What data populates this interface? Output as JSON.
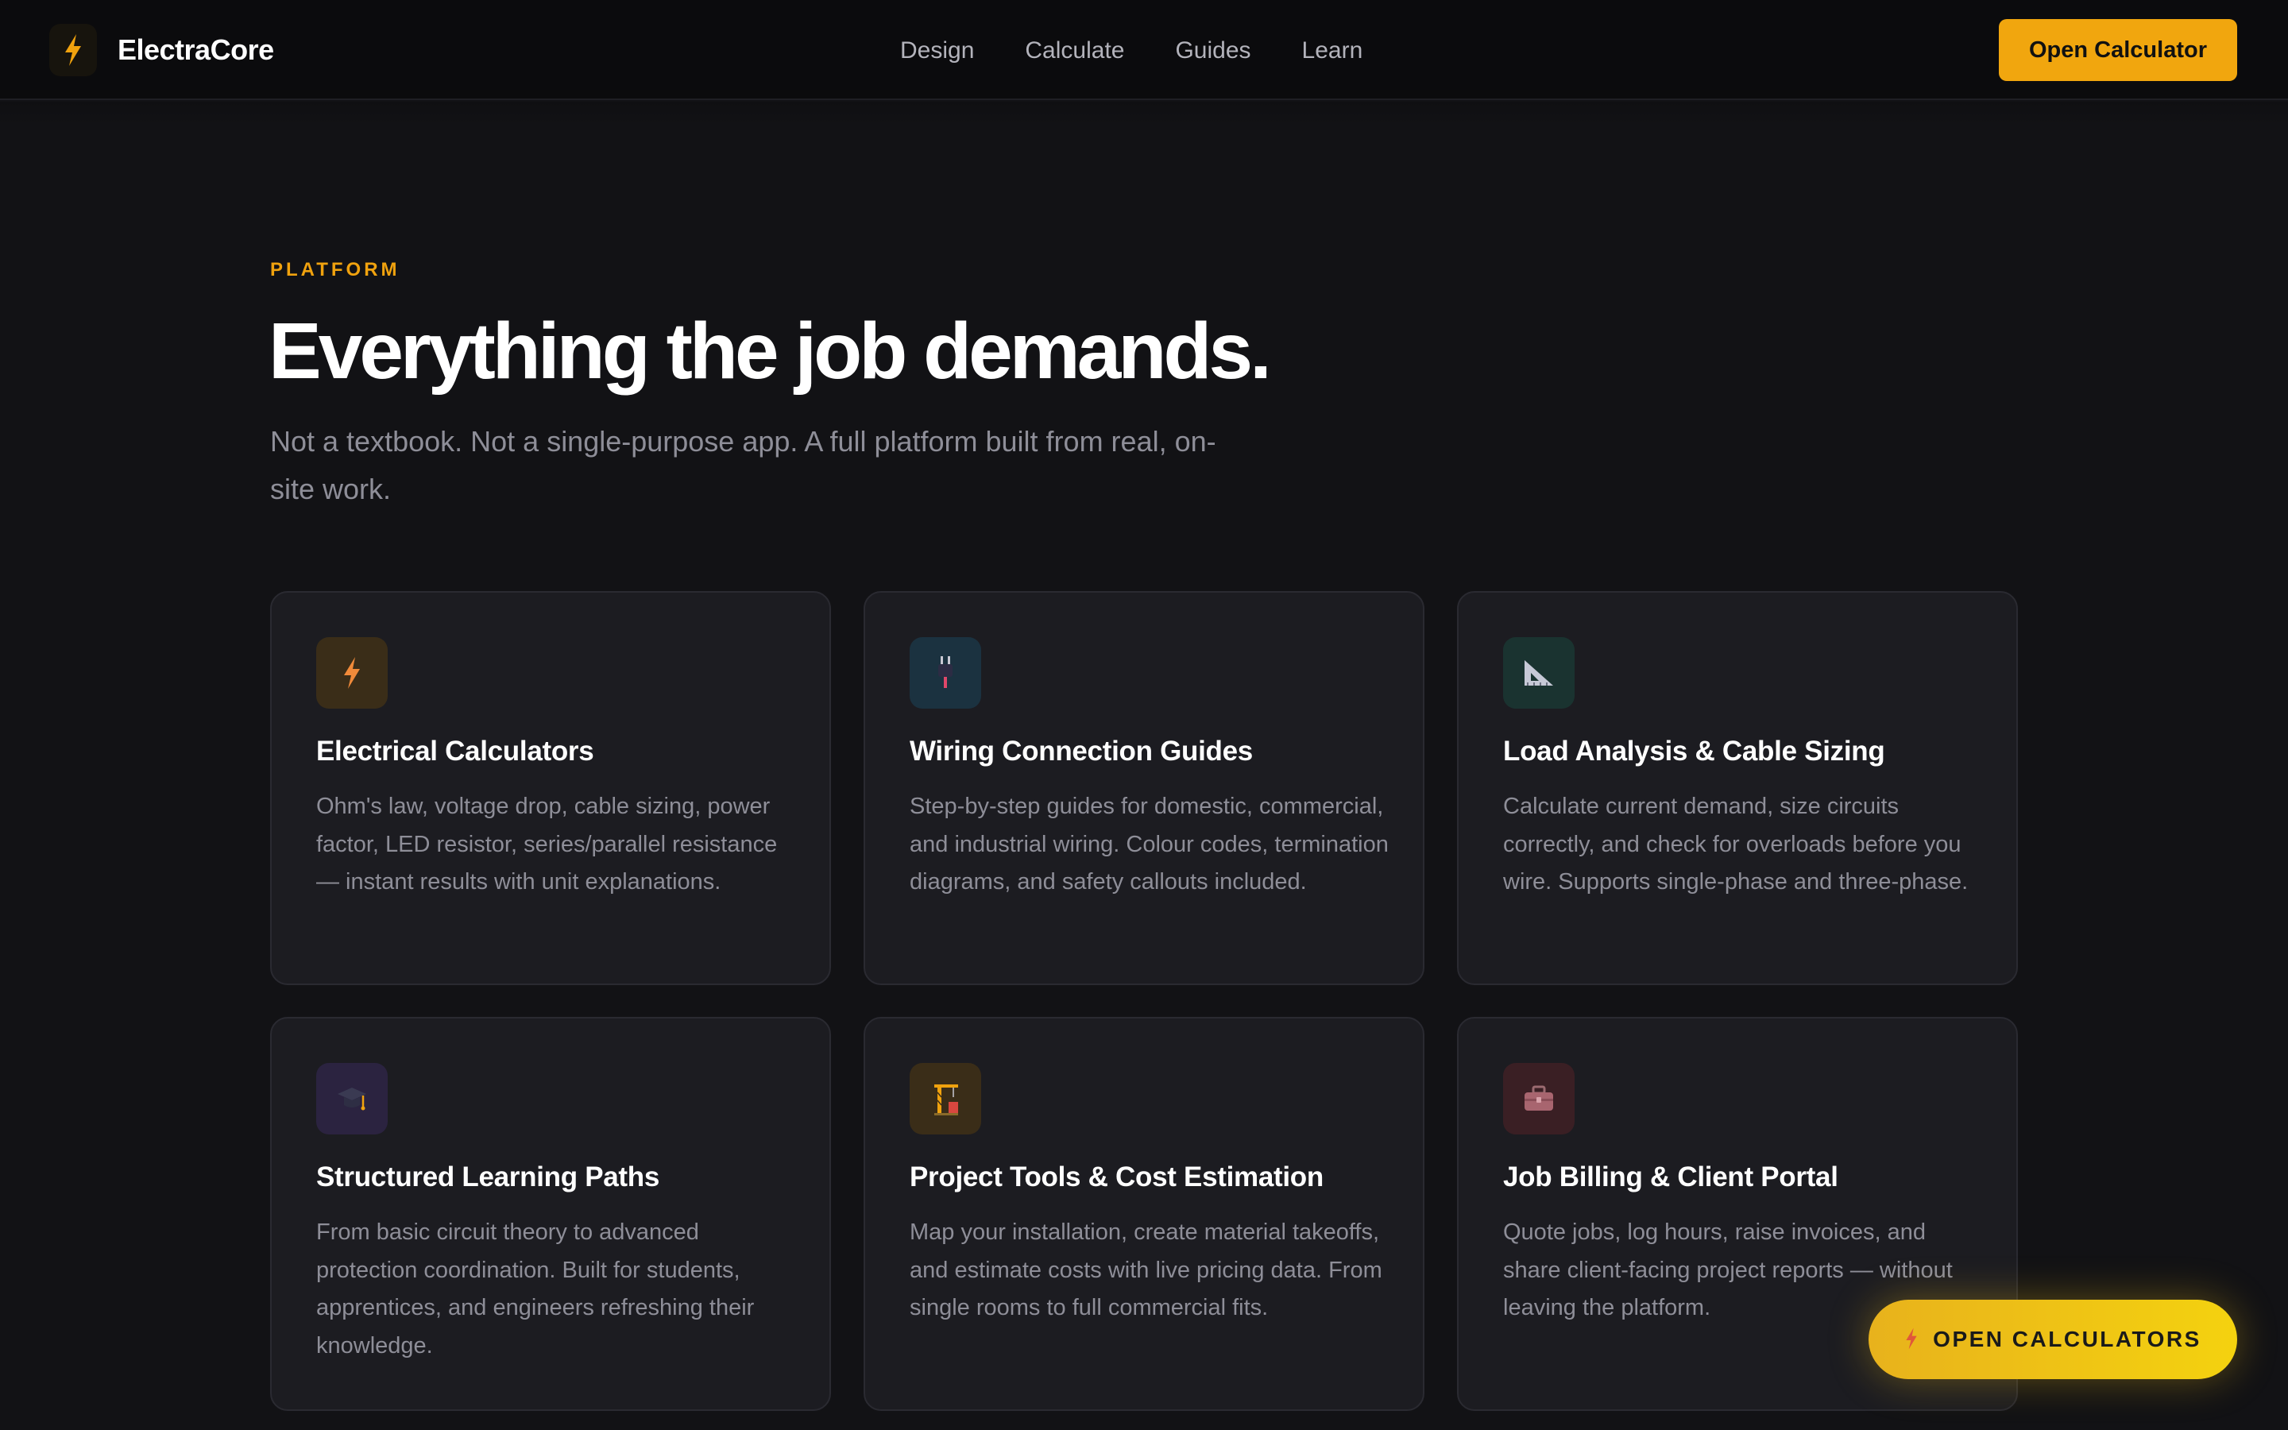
{
  "brand": {
    "name": "ElectraCore",
    "icon": "lightning-bolt-icon"
  },
  "nav": {
    "items": [
      {
        "label": "Design"
      },
      {
        "label": "Calculate"
      },
      {
        "label": "Guides"
      },
      {
        "label": "Learn"
      }
    ]
  },
  "header": {
    "cta_label": "Open Calculator"
  },
  "hero": {
    "eyebrow": "PLATFORM",
    "title": "Everything the job demands.",
    "subtitle": "Not a textbook. Not a single-purpose app. A full platform built from real, on-site work."
  },
  "features": [
    {
      "icon": "lightning-bolt-icon",
      "title": "Electrical Calculators",
      "desc": "Ohm's law, voltage drop, cable sizing, power factor, LED resistor, series/parallel resistance — instant results with unit explanations."
    },
    {
      "icon": "plug-icon",
      "title": "Wiring Connection Guides",
      "desc": "Step-by-step guides for domestic, commercial, and industrial wiring. Colour codes, termination diagrams, and safety callouts included."
    },
    {
      "icon": "triangle-ruler-icon",
      "title": "Load Analysis & Cable Sizing",
      "desc": "Calculate current demand, size circuits correctly, and check for overloads before you wire. Supports single-phase and three-phase."
    },
    {
      "icon": "graduation-cap-icon",
      "title": "Structured Learning Paths",
      "desc": "From basic circuit theory to advanced protection coordination. Built for students, apprentices, and engineers refreshing their knowledge."
    },
    {
      "icon": "construction-crane-icon",
      "title": "Project Tools & Cost Estimation",
      "desc": "Map your installation, create material takeoffs, and estimate costs with live pricing data. From single rooms to full commercial fits."
    },
    {
      "icon": "briefcase-icon",
      "title": "Job Billing & Client Portal",
      "desc": "Quote jobs, log hours, raise invoices, and share client-facing project reports — without leaving the platform."
    }
  ],
  "floating_cta": {
    "label": "OPEN CALCULATORS",
    "icon": "lightning-bolt-icon"
  },
  "colors": {
    "accent": "#f1a60e",
    "background": "#121215",
    "card": "#1c1c21",
    "muted_text": "#8e8e98"
  }
}
